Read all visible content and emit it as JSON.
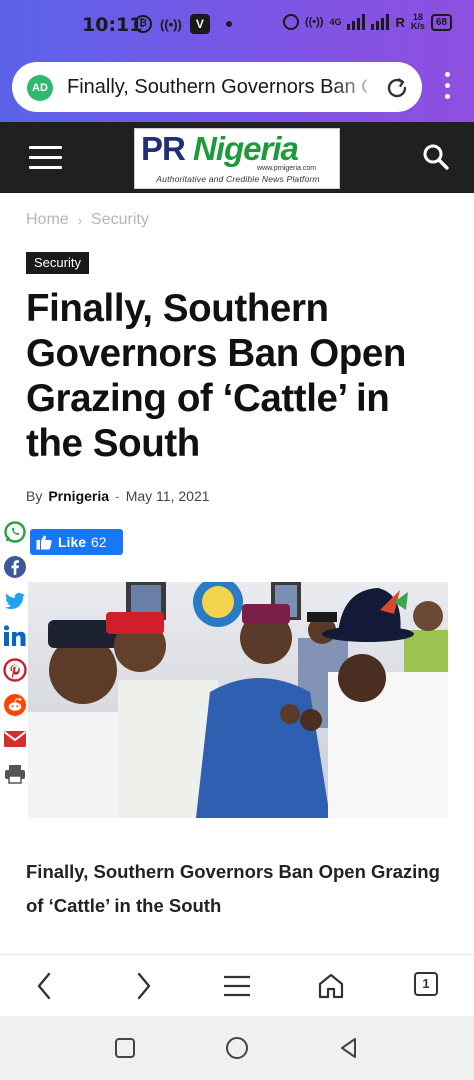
{
  "status_bar": {
    "time": "10:11",
    "network_label": "4G",
    "speed": "18",
    "speed_unit": "K/s",
    "battery": "68"
  },
  "browser": {
    "ad_badge": "AD",
    "url_text": "Finally, Southern Governors Ban Open Grazing of ‘Cattle’ in the South",
    "tab_count": "1"
  },
  "site": {
    "logo_pr": "PR",
    "logo_nigeria": "Nigeria",
    "logo_url": "www.prnigeria.com",
    "logo_tagline": "Authoritative and Credible News Platform"
  },
  "breadcrumb": {
    "home": "Home",
    "separator": "›",
    "current": "Security"
  },
  "article": {
    "category": "Security",
    "title": "Finally, Southern Governors Ban Open Grazing of ‘Cattle’ in the South",
    "by_label": "By",
    "author": "Prnigeria",
    "separator": "-",
    "date": "May 11, 2021",
    "like_label": "Like",
    "like_count": "62",
    "caption": "Finally, Southern Governors Ban Open Grazing of ‘Cattle’ in the South"
  },
  "share_icons": [
    "whatsapp-icon",
    "facebook-icon",
    "twitter-icon",
    "linkedin-icon",
    "pinterest-icon",
    "reddit-icon",
    "email-icon",
    "print-icon"
  ],
  "colors": {
    "chrome_gradient_start": "#5a63e8",
    "chrome_gradient_end": "#8f4fe0",
    "header_bg": "#202020",
    "logo_blue": "#1f2f7a",
    "logo_green": "#1e9a3a",
    "like_blue": "#1877f2"
  }
}
